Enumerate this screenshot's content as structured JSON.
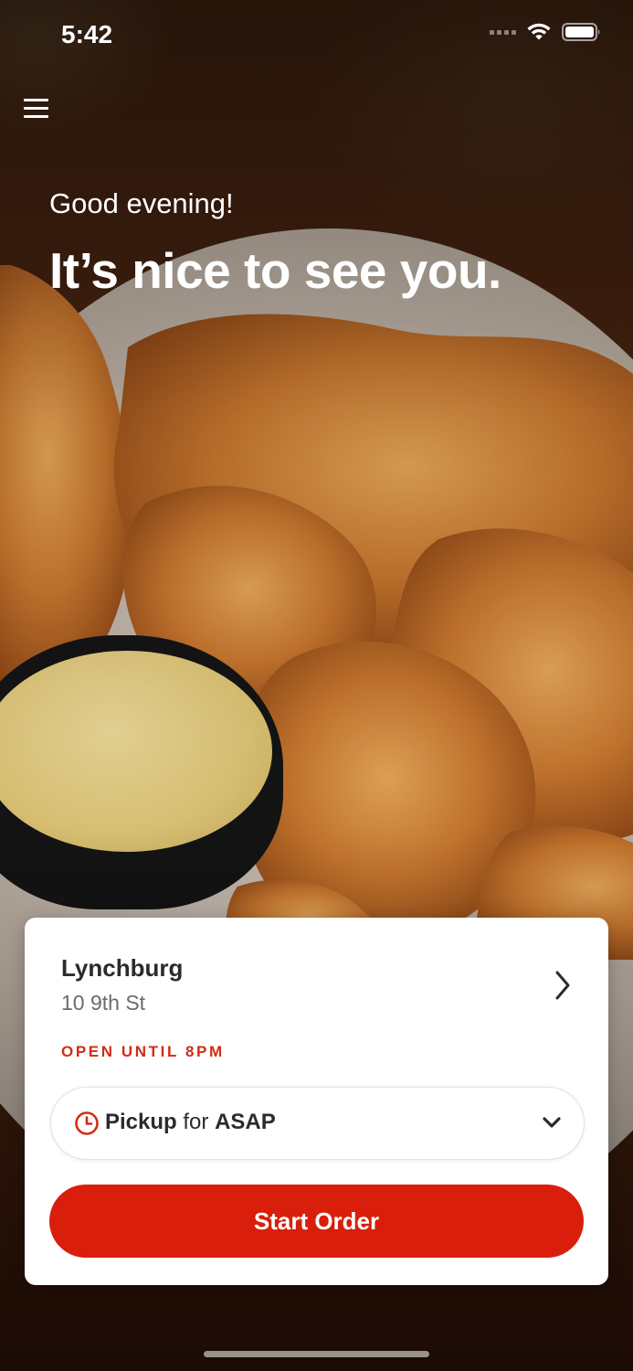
{
  "status_bar": {
    "time": "5:42"
  },
  "hero": {
    "greeting": "Good evening!",
    "headline": "It’s nice to see you."
  },
  "location": {
    "name": "Lynchburg",
    "address": "10 9th St",
    "hours_status": "OPEN UNTIL 8PM"
  },
  "order_mode": {
    "mode": "Pickup",
    "connector": "for",
    "time": "ASAP"
  },
  "actions": {
    "start_order_label": "Start Order"
  },
  "colors": {
    "brand_red": "#d91e0b",
    "status_red": "#d42b13",
    "text_dark": "#2b2b2b",
    "text_muted": "#6b6b6b"
  },
  "icons": {
    "menu": "hamburger-menu-icon",
    "location_chevron": "chevron-right-icon",
    "clock": "clock-icon",
    "dropdown": "chevron-down-icon",
    "wifi": "wifi-icon",
    "battery": "battery-icon"
  }
}
